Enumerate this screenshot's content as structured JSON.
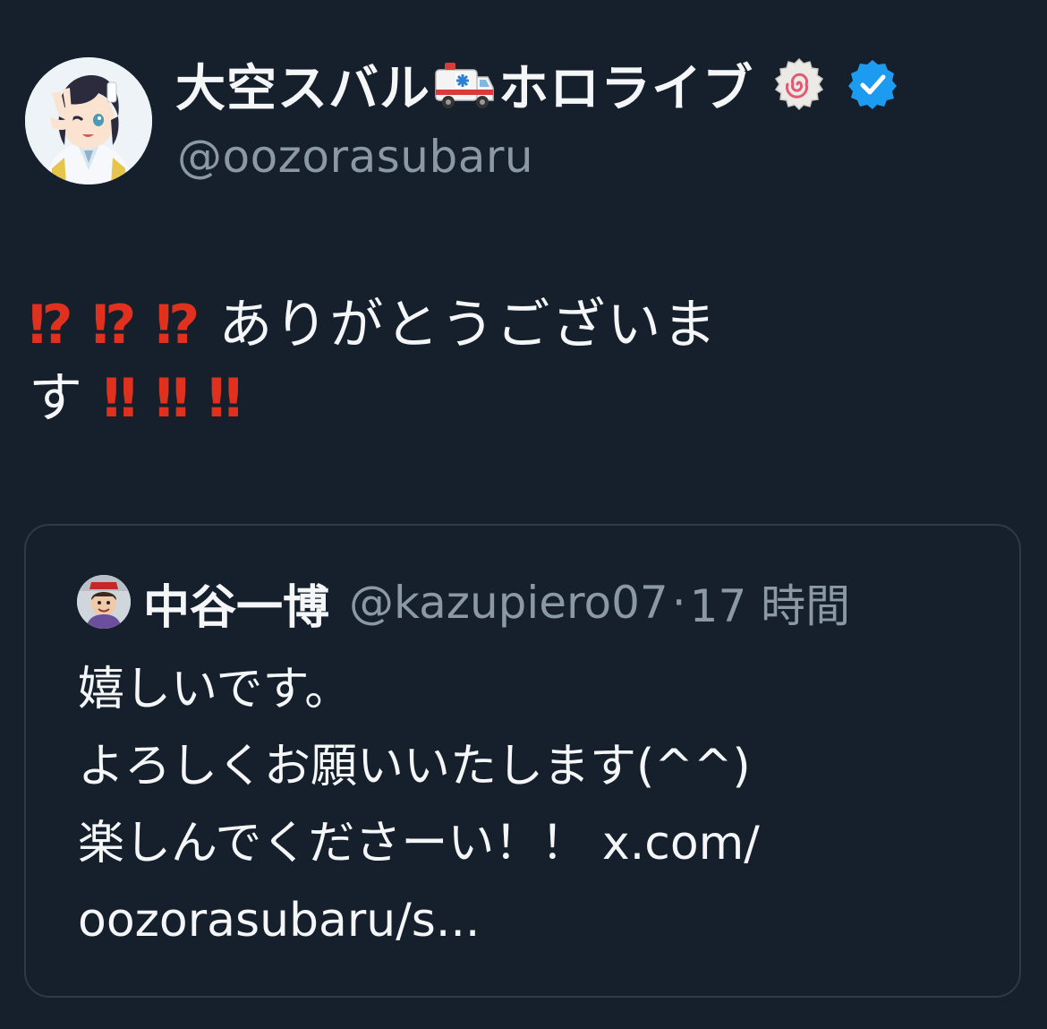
{
  "tweet": {
    "author": {
      "display_name": "大空スバル",
      "display_name_suffix": "ホロライブ",
      "name_emoji": "ambulance-emoji",
      "badges": [
        "naruto-fish-cake-emoji",
        "verified-icon"
      ],
      "handle": "@oozorasubaru"
    },
    "body": {
      "line1_marks": [
        "⁉",
        "⁉",
        "⁉"
      ],
      "line1_text": "ありがとうございま",
      "line2_text": "す",
      "line2_marks": [
        "‼",
        "‼",
        "‼"
      ]
    },
    "quote": {
      "display_name": "中谷一博",
      "handle": "@kazupiero07",
      "separator": "·",
      "time": "17 時間",
      "lines": [
        "嬉しいです。",
        "よろしくお願いいたします(^^)",
        "楽しんでくださーい！！ x.com/",
        "oozorasubaru/s..."
      ]
    }
  },
  "colors": {
    "background": "#16202c",
    "text": "#f4f6f8",
    "secondary_text": "#8b98a5",
    "mark_red": "#e0301e",
    "verified_blue": "#1d9bf0",
    "card_border": "#2f3a45"
  }
}
